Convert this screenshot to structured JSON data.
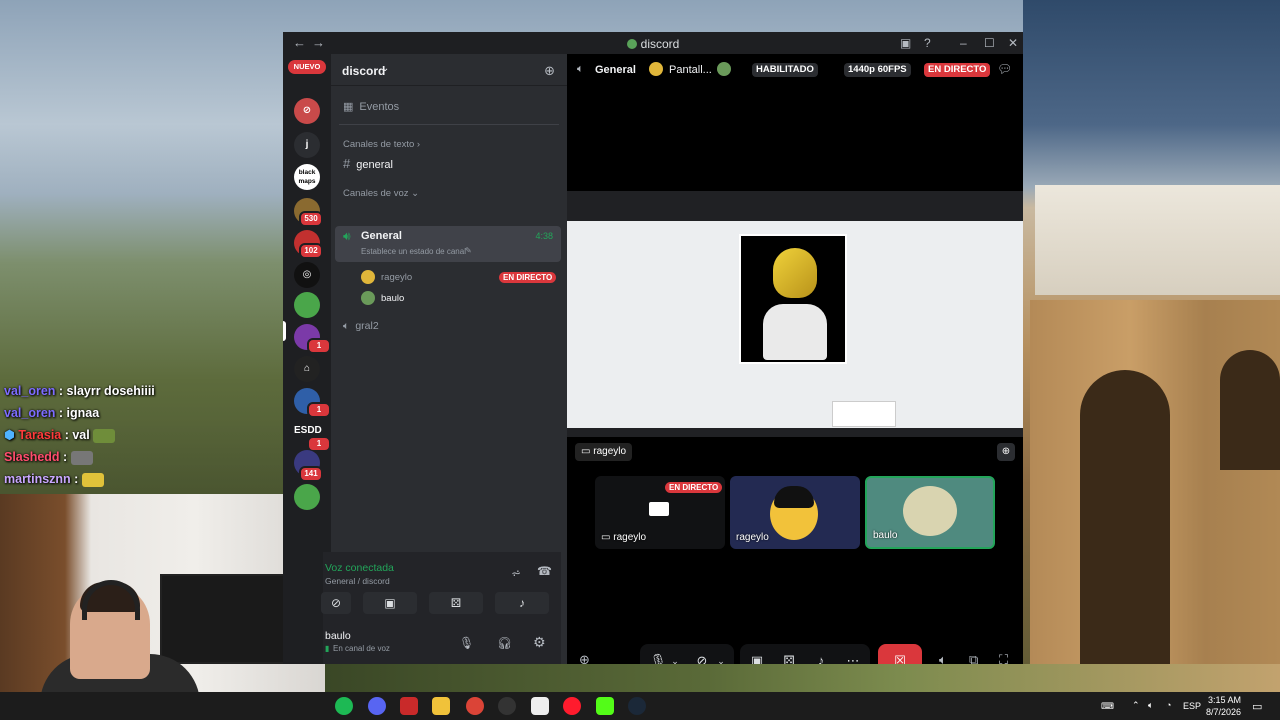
{
  "stream_overlay": {
    "chat": [
      {
        "user": "val_oren",
        "message": "slayrr dosehiiii"
      },
      {
        "user": "val_oren",
        "message": "ignaa"
      },
      {
        "user": "Tarasia",
        "message": "val"
      },
      {
        "user": "Slashedd",
        "message": ""
      },
      {
        "user": "martinsznn",
        "message": ""
      }
    ]
  },
  "window": {
    "title": "discord",
    "nav_back": "←",
    "nav_forward": "→"
  },
  "server_rail": {
    "new_label": "NUEVO",
    "servers": [
      {
        "name": "j"
      },
      {
        "name": "black maps"
      },
      {
        "name": "server-530",
        "badge": "530"
      },
      {
        "name": "server-102",
        "badge": "102"
      },
      {
        "name": "server-1",
        "badge": ""
      },
      {
        "name": "server-2",
        "badge": "1"
      },
      {
        "name": "server-3",
        "badge": ""
      },
      {
        "name": "server-4",
        "badge": "1"
      },
      {
        "name": "ESDD",
        "badge": "1"
      },
      {
        "name": "server-141",
        "badge": "141"
      }
    ]
  },
  "sidebar": {
    "server_name": "discord",
    "events": "Eventos",
    "text_category": "Canales de texto",
    "text_channel": "general",
    "voice_category": "Canales de voz",
    "voice_channel": "General",
    "voice_timer": "4:38",
    "voice_status": "Establece un estado de canal",
    "members": [
      {
        "name": "rageylo",
        "live": "EN DIRECTO"
      },
      {
        "name": "baulo"
      }
    ],
    "other_voice_channel": "gral2"
  },
  "voice_panel": {
    "status": "Voz conectada",
    "location": "General / discord"
  },
  "user_panel": {
    "name": "baulo",
    "status": "En canal de voz"
  },
  "stage": {
    "channel": "General",
    "stream_title": "Pantall...",
    "enabled_pill": "HABILITADO",
    "quality_pill": "1440p 60FPS",
    "live_pill": "EN DIRECTO",
    "stream_label": "rageylo",
    "tiles": [
      {
        "name": "rageylo",
        "live": "EN DIRECTO",
        "type": "screen"
      },
      {
        "name": "rageylo",
        "type": "user"
      },
      {
        "name": "baulo",
        "type": "user"
      }
    ]
  },
  "taskbar": {
    "lang": "ESP",
    "time": "3:15 AM",
    "date": "8/7/2026"
  },
  "colors": {
    "discord_bg": "#1e1f22",
    "sidebar_bg": "#2b2d31",
    "live_red": "#da373c",
    "online_green": "#23a55a",
    "disconnect_red": "#da373c"
  }
}
